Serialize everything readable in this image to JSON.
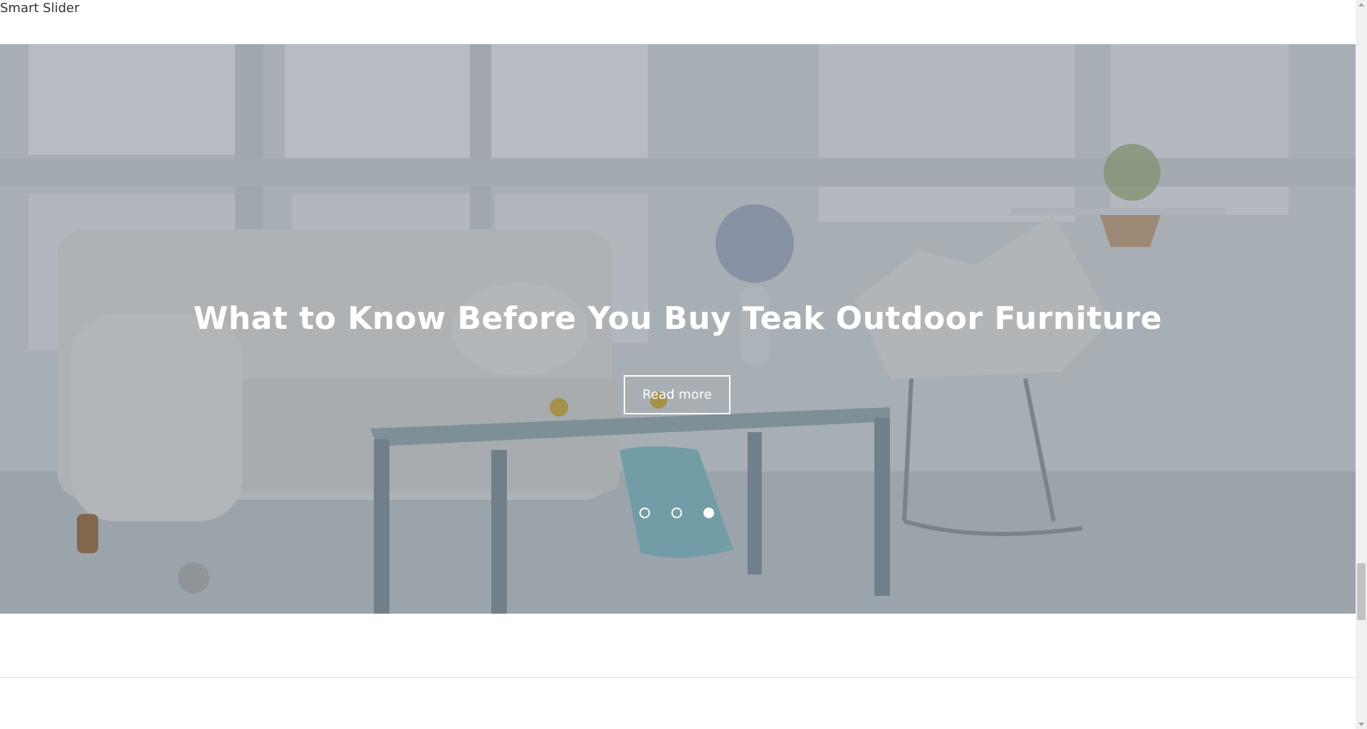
{
  "page": {
    "label": "Smart Slider"
  },
  "slider": {
    "title": "What to Know Before You Buy Teak Outdoor Furniture",
    "button_label": "Read more",
    "dots": [
      {
        "active": false
      },
      {
        "active": false
      },
      {
        "active": true
      }
    ]
  },
  "colors": {
    "overlay": "#28323c",
    "text": "#ffffff",
    "divider": "#e3e3e3"
  }
}
